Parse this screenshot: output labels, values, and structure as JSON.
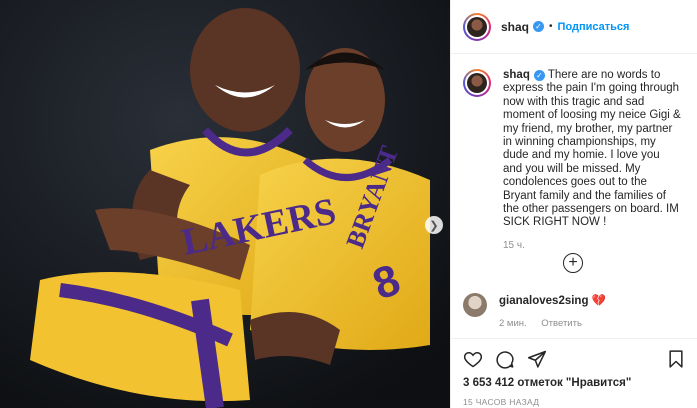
{
  "post": {
    "username": "shaq",
    "follow_label": "Подписаться",
    "caption_user": "shaq",
    "caption": "There are no words to express the pain I'm going through now with this tragic and sad moment of loosing my neice Gigi & my friend, my brother, my partner in winning championships, my dude and my homie. I love you and you will be missed. My condolences goes out to the Bryant family and the families of the other passengers on board. IM SICK RIGHT NOW !",
    "caption_age": "15 ч.",
    "comment": {
      "user": "gianaloves2sing",
      "emoji": "💔",
      "age": "2 мин.",
      "reply_label": "Ответить"
    },
    "likes": "3 653 412 отметок \"Нравится\"",
    "posted_ago": "15 ЧАСОВ НАЗАД"
  },
  "photo": {
    "jersey_text_left": "LAKERS",
    "jersey_text_right": "BRYANT",
    "jersey_number": "8"
  },
  "colors": {
    "link_blue": "#0095f6",
    "verified_blue": "#3897f0",
    "lakers_gold": "#f2c230",
    "lakers_purple": "#4b2a8a"
  },
  "icons": [
    "heart-icon",
    "comment-icon",
    "share-icon",
    "bookmark-icon",
    "plus-circle-icon",
    "chevron-right-icon",
    "verified-icon"
  ]
}
